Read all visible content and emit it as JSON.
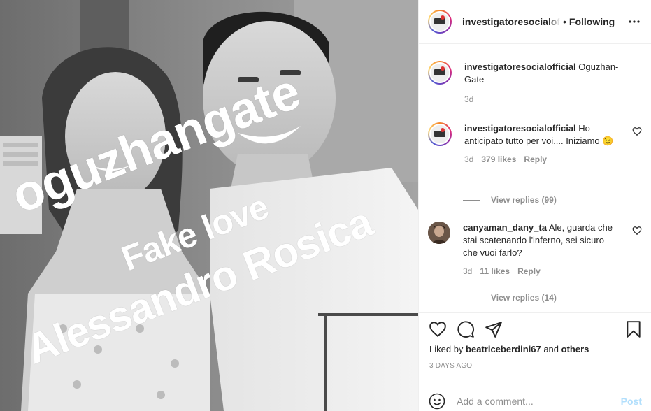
{
  "header": {
    "username": "investigatoresocialofficial",
    "separator": "•",
    "follow_status": "Following",
    "more_icon": "more-horizontal-icon"
  },
  "photo": {
    "overlay_lines": [
      "oguzhangate",
      "Fake love",
      "Alessandro Rosica"
    ]
  },
  "caption": {
    "username": "investigatoresocialofficial",
    "text": "Oguzhan-Gate",
    "time": "3d"
  },
  "comments": [
    {
      "username": "investigatoresocialofficial",
      "text": "Ho anticipato tutto per voi.... Iniziamo",
      "emoji": "😉",
      "time": "3d",
      "likes": "379 likes",
      "reply": "Reply",
      "view_replies": "View replies (99)"
    },
    {
      "username": "canyaman_dany_ta",
      "text": "Ale, guarda che stai scatenando l'inferno, sei sicuro che vuoi farlo?",
      "time": "3d",
      "likes": "11 likes",
      "reply": "Reply",
      "view_replies": "View replies (14)"
    }
  ],
  "actions": {
    "icons": [
      "heart-icon",
      "comment-icon",
      "share-icon",
      "bookmark-icon"
    ],
    "liked_prefix": "Liked by",
    "liked_user": "beatriceberdini67",
    "liked_and": "and",
    "liked_others": "others",
    "time_ago": "3 DAYS AGO"
  },
  "add_comment": {
    "placeholder": "Add a comment...",
    "post_label": "Post"
  },
  "colors": {
    "text": "#262626",
    "secondary": "#8e8e8e",
    "border": "#efefef",
    "post_disabled": "#b2dffc"
  }
}
